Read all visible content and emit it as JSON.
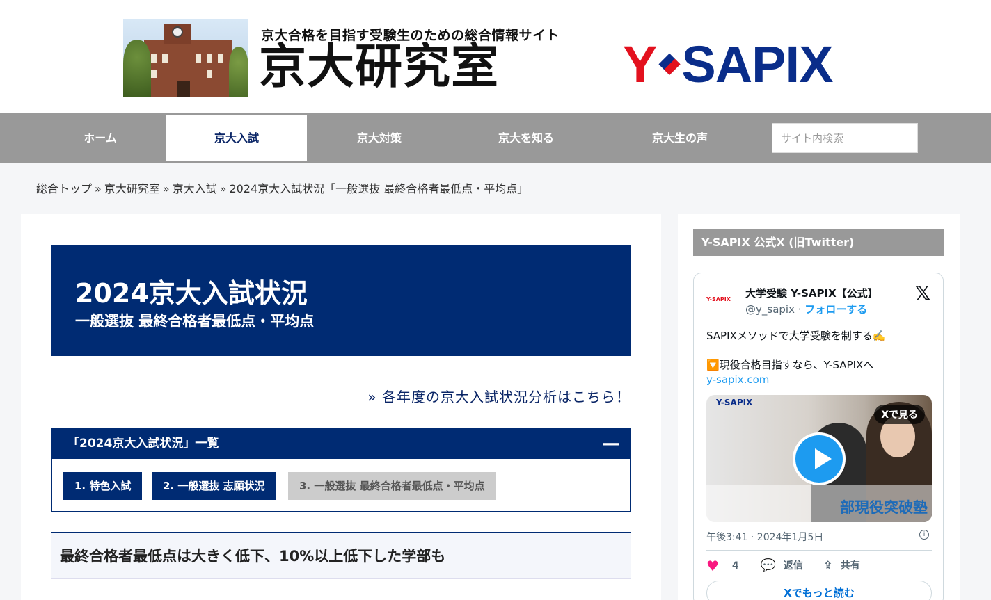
{
  "header": {
    "tagline": "京大合格を目指す受験生のための総合情報サイト",
    "site_name": "京大研究室",
    "brand_y": "Y",
    "brand_sapix": "SAPIX"
  },
  "nav": {
    "items": [
      {
        "label": "ホーム"
      },
      {
        "label": "京大入試"
      },
      {
        "label": "京大対策"
      },
      {
        "label": "京大を知る"
      },
      {
        "label": "京大生の声"
      }
    ],
    "search_placeholder": "サイト内検索"
  },
  "breadcrumb": {
    "items": [
      "総合トップ",
      "京大研究室",
      "京大入試",
      "2024京大入試状況「一般選抜 最終合格者最低点・平均点」"
    ],
    "separator": "»"
  },
  "hero": {
    "title": "2024京大入試状況",
    "subtitle": "一般選抜 最終合格者最低点・平均点"
  },
  "more_link": "» 各年度の京大入試状況分析はこちら！",
  "toc": {
    "title": "「2024京大入試状況」一覧",
    "toggle": "—",
    "buttons": [
      {
        "label": "1. 特色入試"
      },
      {
        "label": "2. 一般選抜 志願状況"
      },
      {
        "label": "3. 一般選抜 最終合格者最低点・平均点"
      }
    ]
  },
  "section_heading": "最終合格者最低点は大きく低下、10%以上低下した学部も",
  "sidebar": {
    "heading": "Y-SAPIX 公式X (旧Twitter)",
    "tweet": {
      "avatar_text": "Y-SAPIX",
      "name": "大学受験 Y-SAPIX【公式】",
      "handle": "@y_sapix",
      "handle_sep": "·",
      "follow": "フォローする",
      "text1": "SAPIXメソッドで大学受験を制する✍️",
      "text2": "🔽現役合格目指すなら、Y-SAPIXへ",
      "link": "y-sapix.com",
      "media_logo_y": "Y-",
      "media_logo_s": "SAPIX",
      "media_badge": "Xで見る",
      "media_caption": "部現役突破塾",
      "timestamp": "午後3:41 · 2024年1月5日",
      "info_icon": "i",
      "likes": "4",
      "reply": "返信",
      "share": "共有",
      "more": "Xでもっと読む"
    }
  },
  "icons": {
    "x_logo": "x-logo-icon",
    "heart": "heart-icon",
    "reply": "reply-bubble-icon",
    "share": "share-icon",
    "play": "play-icon",
    "info": "info-icon"
  },
  "colors": {
    "navy": "#002b73",
    "nav_gray": "#999999",
    "brand_red": "#e3111e",
    "brand_blue": "#0a2d8a",
    "twitter_blue": "#1d9bf0"
  }
}
